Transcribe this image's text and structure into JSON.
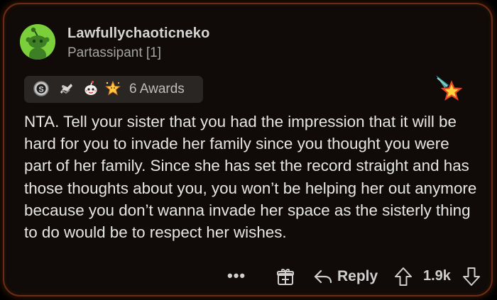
{
  "comment": {
    "author": "Lawfullychaoticneko",
    "flair": "Partassipant [1]",
    "awards": {
      "icons": [
        "silver-award-icon",
        "hugz-award-icon",
        "wholesome-award-icon",
        "starstruck-award-icon"
      ],
      "count_label": "6 Awards"
    },
    "body": "NTA. Tell your sister that you had the impression that it will be hard for you to invade her family since you thought you were part of her family. Since she has set the record straight and has those thoughts about you, you won’t be helping her out anymore because you don’t wanna invade her space as the sisterly thing to do would be to respect her wishes.",
    "actions": {
      "more_label": "•••",
      "reply_label": "Reply",
      "score": "1.9k"
    }
  },
  "colors": {
    "background": "#000000",
    "card": "#100b08",
    "card_border": "#6a2c12",
    "avatar": "#7bcf3a"
  }
}
